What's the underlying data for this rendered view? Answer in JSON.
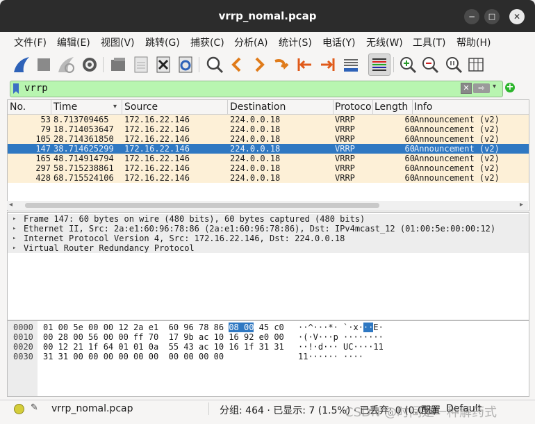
{
  "window": {
    "title": "vrrp_nomal.pcap",
    "minimize": "−",
    "maximize": "□",
    "close": "✕"
  },
  "menu": [
    "文件(F)",
    "编辑(E)",
    "视图(V)",
    "跳转(G)",
    "捕获(C)",
    "分析(A)",
    "统计(S)",
    "电话(Y)",
    "无线(W)",
    "工具(T)",
    "帮助(H)"
  ],
  "toolbar_icons": [
    "shark-fin-start-icon",
    "stop-square-icon",
    "restart-shark-icon",
    "gear-options-icon",
    "open-folder-icon",
    "save-file-icon",
    "close-file-icon",
    "reload-file-icon",
    "find-packet-icon",
    "go-back-icon",
    "go-forward-icon",
    "go-to-packet-icon",
    "first-packet-icon",
    "last-packet-icon",
    "autoscroll-icon",
    "colorize-icon",
    "zoom-in-icon",
    "zoom-out-icon",
    "normal-size-icon",
    "resize-columns-icon"
  ],
  "filter": {
    "value": "vrrp",
    "clear": "✕",
    "apply": "⇨",
    "dropdown": "▾",
    "add": "+"
  },
  "packet_list": {
    "columns": [
      "No.",
      "Time",
      "Source",
      "Destination",
      "Protoco",
      "Length",
      "Info"
    ],
    "sort_indicator": "▾",
    "rows": [
      {
        "no": "53",
        "time": "8.713709465",
        "src": "172.16.22.146",
        "dst": "224.0.0.18",
        "proto": "VRRP",
        "len": "60",
        "info": "Announcement (v2)",
        "selected": false
      },
      {
        "no": "79",
        "time": "18.714053647",
        "src": "172.16.22.146",
        "dst": "224.0.0.18",
        "proto": "VRRP",
        "len": "60",
        "info": "Announcement (v2)",
        "selected": false
      },
      {
        "no": "105",
        "time": "28.714361850",
        "src": "172.16.22.146",
        "dst": "224.0.0.18",
        "proto": "VRRP",
        "len": "60",
        "info": "Announcement (v2)",
        "selected": false
      },
      {
        "no": "147",
        "time": "38.714625299",
        "src": "172.16.22.146",
        "dst": "224.0.0.18",
        "proto": "VRRP",
        "len": "60",
        "info": "Announcement (v2)",
        "selected": true
      },
      {
        "no": "165",
        "time": "48.714914794",
        "src": "172.16.22.146",
        "dst": "224.0.0.18",
        "proto": "VRRP",
        "len": "60",
        "info": "Announcement (v2)",
        "selected": false
      },
      {
        "no": "297",
        "time": "58.715238861",
        "src": "172.16.22.146",
        "dst": "224.0.0.18",
        "proto": "VRRP",
        "len": "60",
        "info": "Announcement (v2)",
        "selected": false
      },
      {
        "no": "428",
        "time": "68.715524106",
        "src": "172.16.22.146",
        "dst": "224.0.0.18",
        "proto": "VRRP",
        "len": "60",
        "info": "Announcement (v2)",
        "selected": false
      }
    ]
  },
  "details": [
    "Frame 147: 60 bytes on wire (480 bits), 60 bytes captured (480 bits)",
    "Ethernet II, Src: 2a:e1:60:96:78:86 (2a:e1:60:96:78:86), Dst: IPv4mcast_12 (01:00:5e:00:00:12)",
    "Internet Protocol Version 4, Src: 172.16.22.146, Dst: 224.0.0.18",
    "Virtual Router Redundancy Protocol"
  ],
  "details_expander": "▸",
  "hex": [
    {
      "offset": "0000",
      "pre": "01 00 5e 00 00 12 2a e1  60 96 78 86 ",
      "hl": "08 00",
      "post": " 45 c0",
      "ascii_pre": "··^···*· `·x·",
      "ascii_hl": "··",
      "ascii_post": "E·"
    },
    {
      "offset": "0010",
      "pre": "00 28 00 56 00 00 ff 70  17 9b ac 10 16 92 e0 00",
      "hl": "",
      "post": "",
      "ascii_pre": "·(·V···p ········",
      "ascii_hl": "",
      "ascii_post": ""
    },
    {
      "offset": "0020",
      "pre": "00 12 21 1f 64 01 01 0a  55 43 ac 10 16 1f 31 31",
      "hl": "",
      "post": "",
      "ascii_pre": "··!·d··· UC····11",
      "ascii_hl": "",
      "ascii_post": ""
    },
    {
      "offset": "0030",
      "pre": "31 31 00 00 00 00 00 00  00 00 00 00",
      "hl": "",
      "post": "",
      "ascii_pre": "11······ ····",
      "ascii_hl": "",
      "ascii_post": ""
    }
  ],
  "status": {
    "file": "vrrp_nomal.pcap",
    "stats": "分组: 464 · 已显示: 7 (1.5%) · 已丢弃: 0 (0.0%)",
    "profile_label": "配置",
    "profile": "Default",
    "watermark": "CSDN @时间是一种解药式"
  }
}
